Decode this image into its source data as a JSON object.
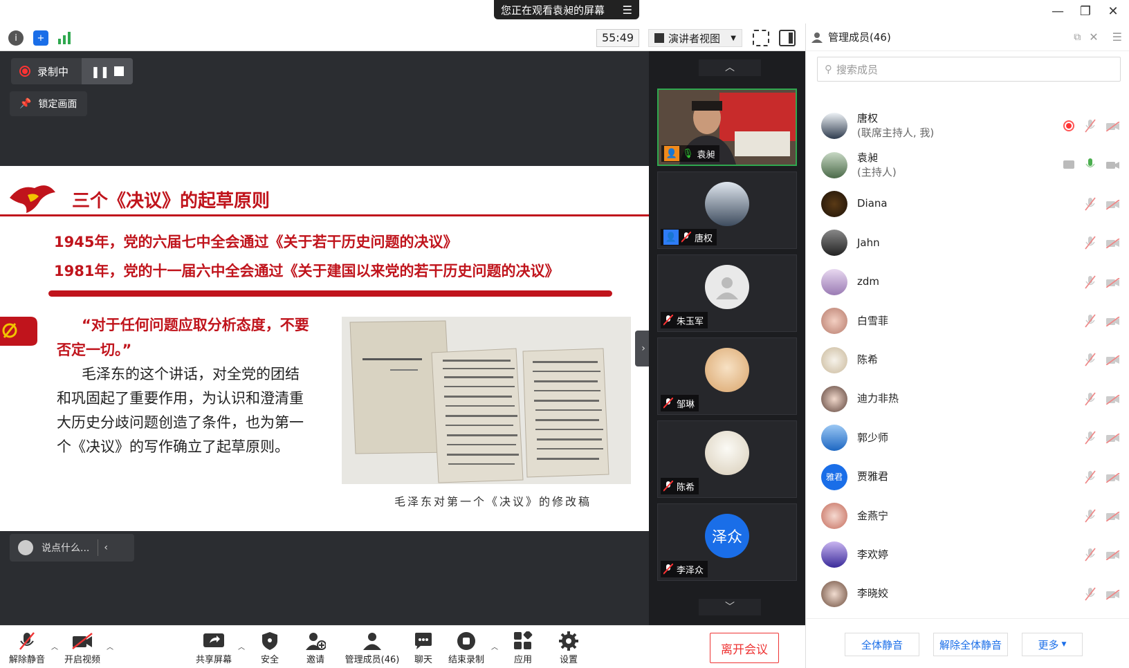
{
  "title_bar": {
    "watching_banner": "您正在观看袁昶的屏幕"
  },
  "meeting_bar": {
    "timer": "55:49",
    "view_mode": "演讲者视图"
  },
  "stage": {
    "recording_label": "录制中",
    "lock_screen_label": "锁定画面",
    "chat_placeholder": "说点什么..."
  },
  "slide": {
    "title": "三个《决议》的起草原则",
    "line1": "1945年，党的六届七中全会通过《关于若干历史问题的决议》",
    "line2": "1981年，党的十一届六中全会通过《关于建国以来党的若干历史问题的决议》",
    "quote": "“对于任何问题应取分析态度，不要否定一切。”",
    "body": "毛泽东的这个讲话，对全党的团结和巩固起了重要作用，为认识和澄清重大历史分歧问题创造了条件，也为第一个《决议》的写作确立了起草原则。",
    "photo_caption": "毛泽东对第一个《决议》的修改稿"
  },
  "gallery": {
    "tiles": [
      {
        "name": "袁昶"
      },
      {
        "name": "唐权"
      },
      {
        "name": "朱玉军"
      },
      {
        "name": "邹琳"
      },
      {
        "name": "陈希"
      },
      {
        "name": "李泽众",
        "avatar_text": "泽众"
      }
    ]
  },
  "controls": {
    "unmute": "解除静音",
    "start_video": "开启视频",
    "share_screen": "共享屏幕",
    "security": "安全",
    "invite": "邀请",
    "manage_members": "管理成员(46)",
    "chat": "聊天",
    "end_recording": "结束录制",
    "apps": "应用",
    "settings": "设置",
    "leave": "离开会议"
  },
  "panel": {
    "title": "管理成员(46)",
    "search_placeholder": "搜索成员",
    "members": [
      {
        "name": "唐权",
        "role": "(联席主持人, 我)"
      },
      {
        "name": "袁昶",
        "role": "(主持人)"
      },
      {
        "name": "Diana"
      },
      {
        "name": "Jahn"
      },
      {
        "name": "zdm"
      },
      {
        "name": "白雪菲"
      },
      {
        "name": "陈希"
      },
      {
        "name": "迪力非热"
      },
      {
        "name": "郭少师"
      },
      {
        "name": "贾雅君",
        "avatar_text": "雅君"
      },
      {
        "name": "金燕宁"
      },
      {
        "name": "李欢婷"
      },
      {
        "name": "李晓姣"
      }
    ],
    "mute_all": "全体静音",
    "unmute_all": "解除全体静音",
    "more": "更多"
  },
  "colors": {
    "accent_red": "#c0141c",
    "brand_blue": "#1a6ee8",
    "stage_bg": "#2b2d31"
  }
}
